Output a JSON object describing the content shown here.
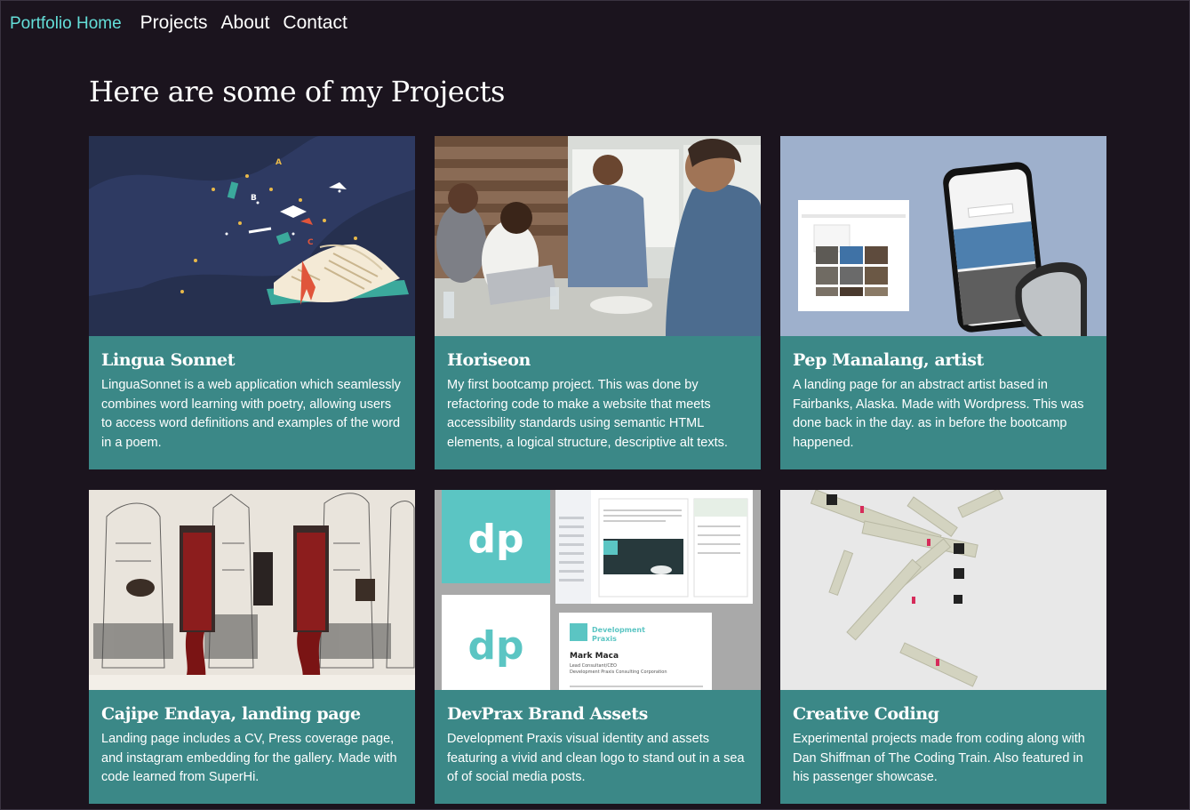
{
  "nav": {
    "home": "Portfolio Home",
    "links": [
      "Projects",
      "About",
      "Contact"
    ]
  },
  "page": {
    "heading": "Here are some of my Projects"
  },
  "projects": [
    {
      "title": "Lingua Sonnet",
      "description": "LinguaSonnet is a web application which seamlessly combines word learning with poetry, allowing users to access word definitions and examples of the word in a poem.",
      "image": "open-book-illustration"
    },
    {
      "title": "Horiseon",
      "description": "My first bootcamp project. This was done by refactoring code to make a website that meets accessibility standards using semantic HTML elements, a logical structure, descriptive alt texts.",
      "image": "team-meeting-photo"
    },
    {
      "title": "Pep Manalang, artist",
      "description": "A landing page for an abstract artist based in Fairbanks, Alaska. Made with Wordpress. This was done back in the day. as in before the bootcamp happened.",
      "image": "website-mockup-on-phone"
    },
    {
      "title": "Cajipe Endaya, landing page",
      "description": "Landing page includes a CV, Press coverage page, and instagram embedding for the gallery. Made with code learned from SuperHi.",
      "image": "artwork-drawings"
    },
    {
      "title": "DevPrax Brand Assets",
      "description": "Development Praxis visual identity and assets featuring a vivid and clean logo to stand out in a sea of of social media posts.",
      "image": "brand-assets-collage",
      "assets": {
        "logo": "dp",
        "brand_line_1": "Development",
        "brand_line_2": "Praxis",
        "card_name": "Mark Maca",
        "card_role": "Lead Consultant/CEO",
        "card_org": "Development Praxis Consulting Corporation"
      }
    },
    {
      "title": "Creative Coding",
      "description": "Experimental projects made from coding along with Dan Shiffman of The Coding Train. Also featured in his passenger showcase.",
      "image": "generative-sketch"
    }
  ],
  "colors": {
    "background": "#1b141e",
    "card": "#3b8887",
    "accent": "#64dfd9",
    "text": "#ffffff"
  }
}
